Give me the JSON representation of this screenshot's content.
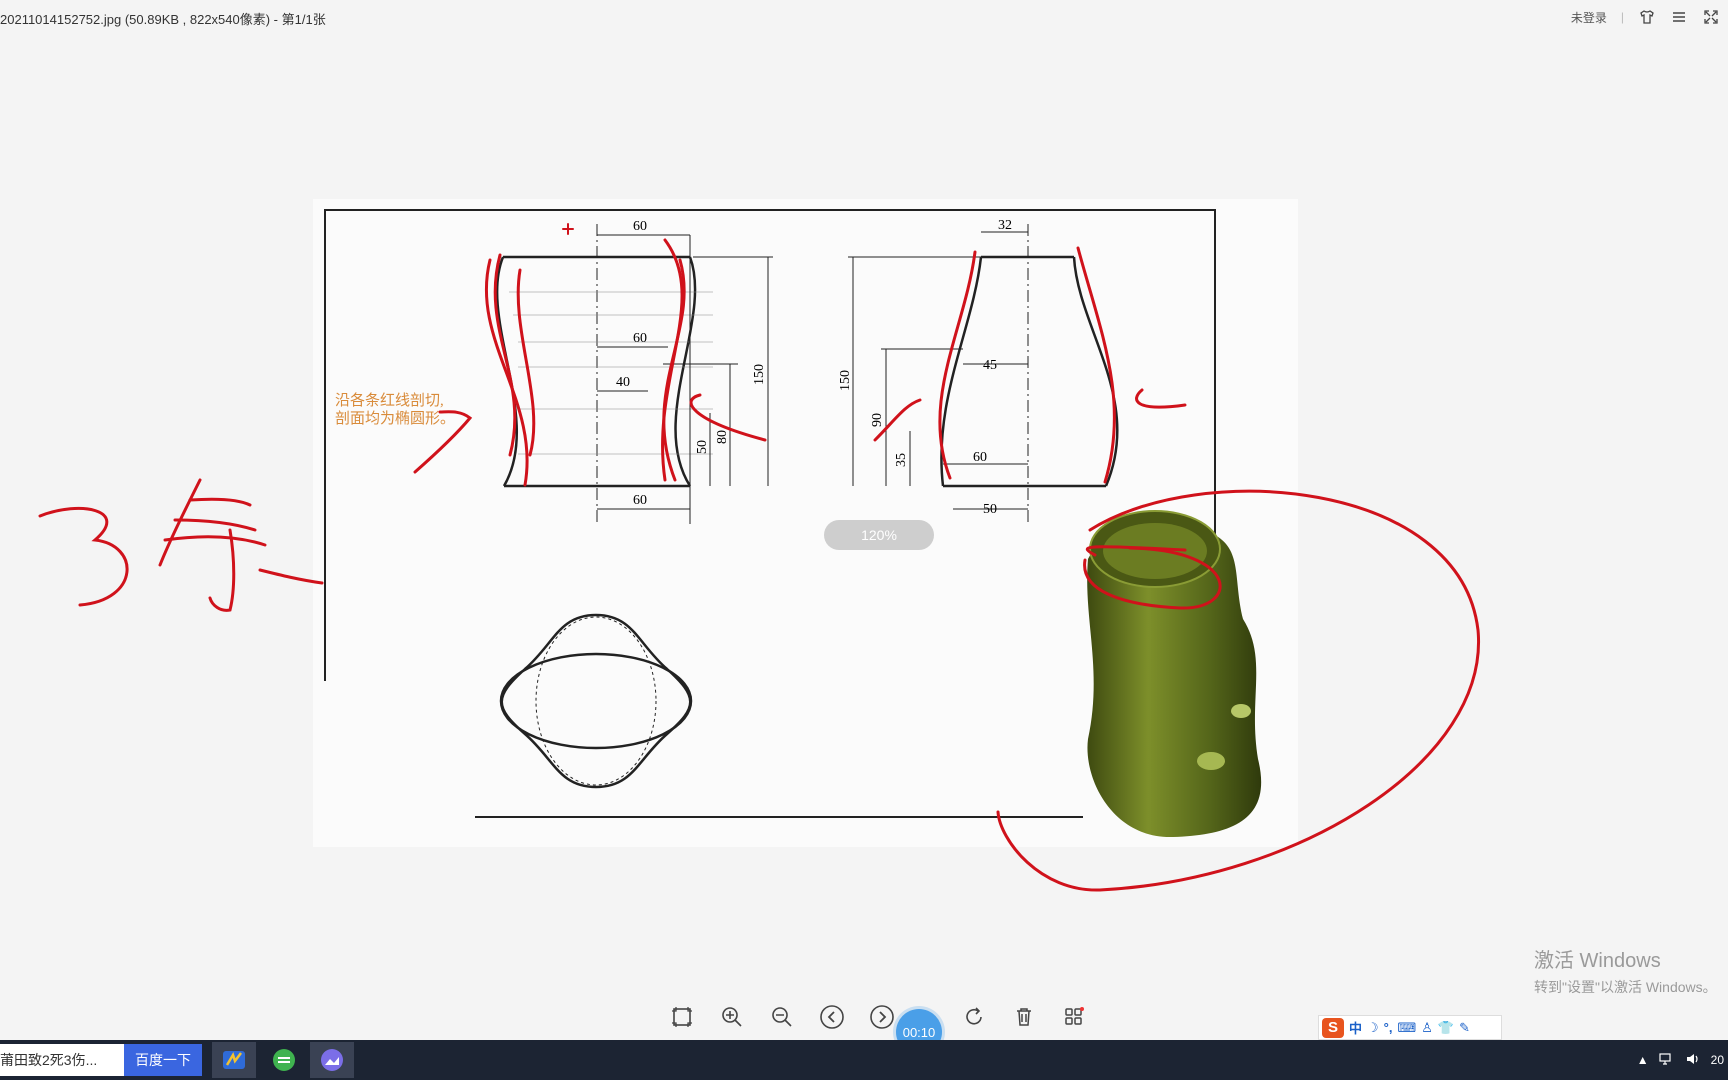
{
  "titlebar": {
    "title": "20211014152752.jpg (50.89KB , 822x540像素) - 第1/1张",
    "login_label": "未登录",
    "separator": "|"
  },
  "drawing": {
    "note_line1": "沿各条红线剖切,",
    "note_line2": "剖面均为椭圆形。",
    "dimensions": {
      "top_60": "60",
      "mid_60": "60",
      "d40": "40",
      "d150_left": "150",
      "d80": "80",
      "d50_left": "50",
      "bottom_60": "60",
      "d32": "32",
      "d150_right": "150",
      "d45": "45",
      "d90": "90",
      "d35": "35",
      "d60_right": "60",
      "d50_right": "50"
    }
  },
  "annotation": {
    "text": "3条"
  },
  "zoom": {
    "level": "120%"
  },
  "timer": {
    "value": "00:10"
  },
  "watermark": {
    "title": "激活 Windows",
    "subtitle": "转到\"设置\"以激活 Windows。"
  },
  "ime": {
    "lang": "中",
    "logo": "S"
  },
  "taskbar": {
    "search_text": "莆田致2死3伤...",
    "search_button": "百度一下",
    "clock": "20"
  },
  "icons": {
    "skin": "shirt-icon",
    "menu": "menu-icon",
    "fullscreen": "fullscreen-icon",
    "fit": "fit-window-icon",
    "zoom_in": "zoom-in-icon",
    "zoom_out": "zoom-out-icon",
    "prev": "prev-icon",
    "next": "next-icon",
    "rotate": "rotate-icon",
    "delete": "trash-icon",
    "grid": "grid-icon"
  },
  "colors": {
    "ink": "#d0121b",
    "model": "#5a6b1c",
    "timer": "#4a9fe8",
    "search_button": "#3a66e0"
  }
}
